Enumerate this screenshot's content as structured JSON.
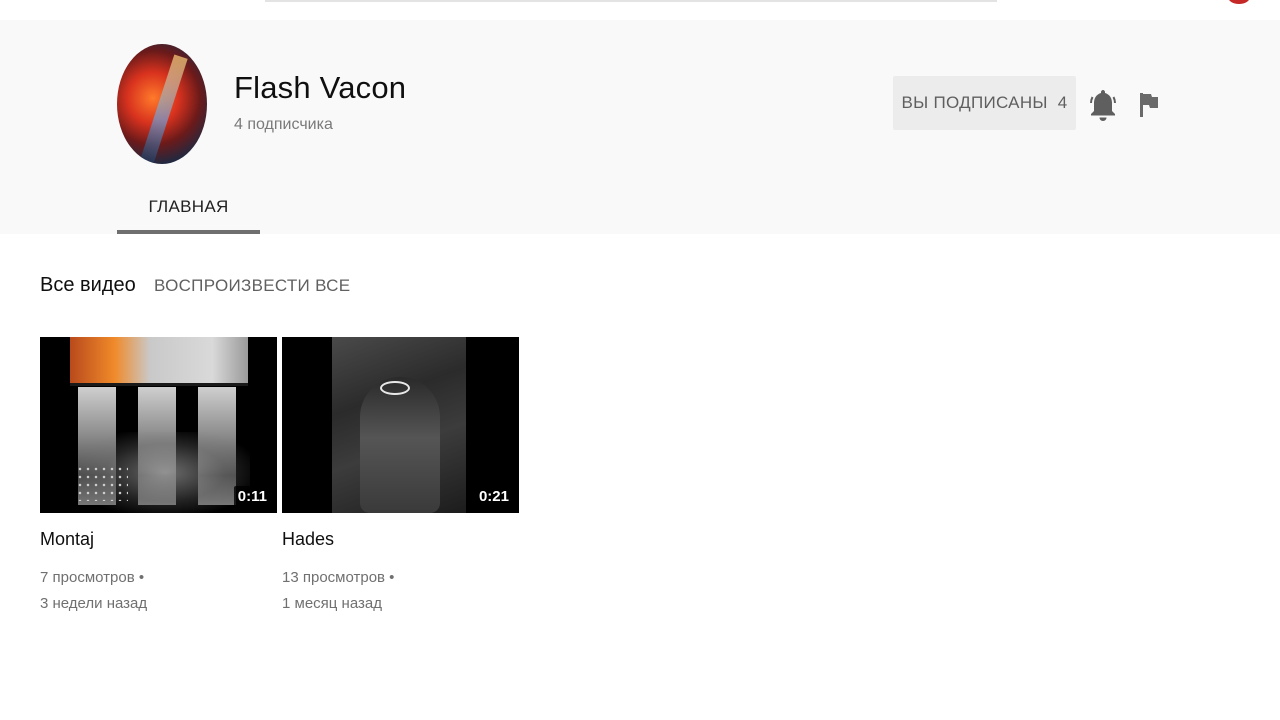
{
  "channel": {
    "name": "Flash Vacon",
    "subscribers": "4 подписчика",
    "subscribe_button": {
      "label": "ВЫ ПОДПИСАНЫ",
      "count": "4"
    },
    "icons": {
      "notifications": "bell-icon",
      "report": "flag-icon"
    },
    "tabs": [
      {
        "label": "ГЛАВНАЯ",
        "active": true
      }
    ]
  },
  "section": {
    "title": "Все видео",
    "play_all": "ВОСПРОИЗВЕСТИ ВСЕ"
  },
  "videos": [
    {
      "title": "Montaj",
      "duration": "0:11",
      "views": "7 просмотров •",
      "age": "3 недели назад"
    },
    {
      "title": "Hades",
      "duration": "0:21",
      "views": "13 просмотров •",
      "age": "1 месяц назад"
    }
  ],
  "colors": {
    "header_background": "#f9f9f9",
    "subscribed_button": "#ececec",
    "tab_underline": "#6f6f6f",
    "meta_text": "#707070"
  }
}
